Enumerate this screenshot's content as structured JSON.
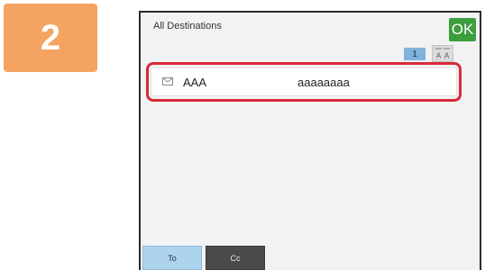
{
  "step": {
    "number": "2",
    "color": "#f4a460"
  },
  "panel": {
    "title": "All Destinations",
    "ok_label": "OK",
    "page_number": "1",
    "sort_icon": "sort-az-icon"
  },
  "destinations": [
    {
      "icon": "email-icon",
      "name": "AAA",
      "address": "aaaaaaaa",
      "highlighted": true,
      "highlight_color": "#d72b3a"
    }
  ],
  "tabs": [
    {
      "label": "To",
      "selected": true
    },
    {
      "label": "Cc",
      "selected": false
    }
  ]
}
